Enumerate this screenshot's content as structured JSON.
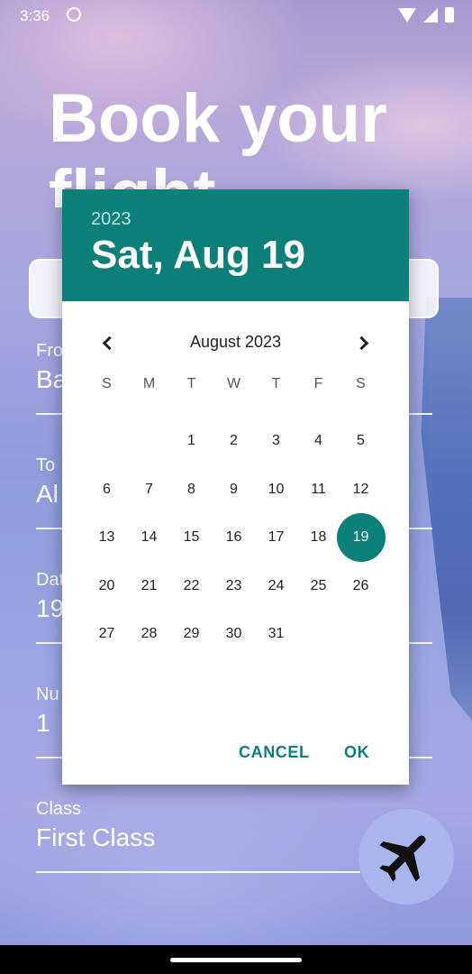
{
  "status_bar": {
    "time": "3:36"
  },
  "screen": {
    "headline": "Book your flight",
    "fields": [
      {
        "label": "Fro",
        "value": "Ba"
      },
      {
        "label": "To",
        "value": "Al"
      },
      {
        "label": "Dat",
        "value": "19"
      },
      {
        "label": "Nu",
        "value": "1"
      },
      {
        "label": "Class",
        "value": "First Class"
      }
    ],
    "fab_icon": "airplane-icon"
  },
  "date_picker": {
    "year": "2023",
    "selected_date": "Sat, Aug 19",
    "month_label": "August 2023",
    "weekdays": [
      "S",
      "M",
      "T",
      "W",
      "T",
      "F",
      "S"
    ],
    "weeks": [
      [
        "",
        "",
        "1",
        "2",
        "3",
        "4",
        "5"
      ],
      [
        "6",
        "7",
        "8",
        "9",
        "10",
        "11",
        "12"
      ],
      [
        "13",
        "14",
        "15",
        "16",
        "17",
        "18",
        "19"
      ],
      [
        "20",
        "21",
        "22",
        "23",
        "24",
        "25",
        "26"
      ],
      [
        "27",
        "28",
        "29",
        "30",
        "31",
        "",
        ""
      ]
    ],
    "selected_day": "19",
    "cancel_label": "CANCEL",
    "ok_label": "OK"
  },
  "colors": {
    "accent": "#0b7f78"
  }
}
